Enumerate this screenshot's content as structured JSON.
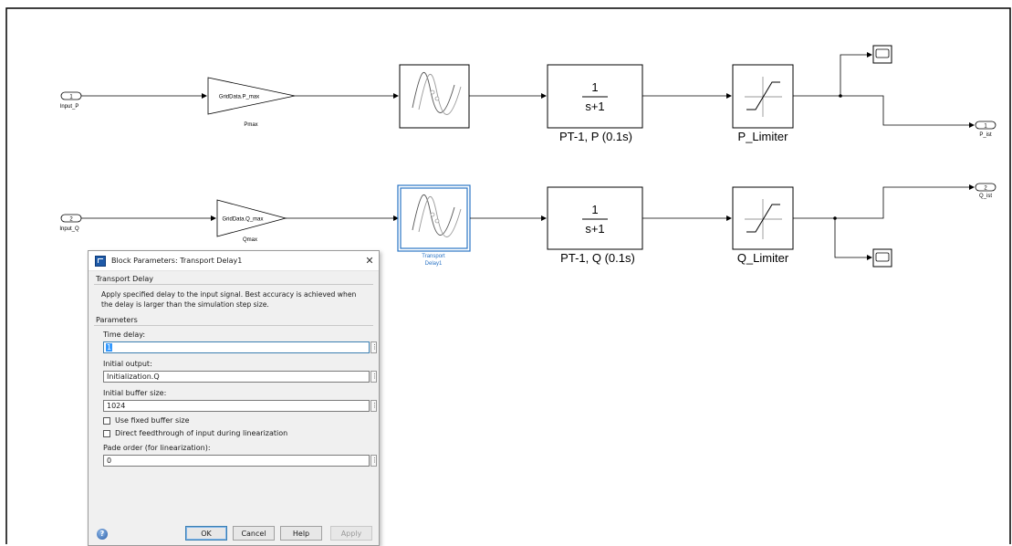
{
  "diagram": {
    "inports": [
      {
        "number": "1",
        "label": "Input_P"
      },
      {
        "number": "2",
        "label": "Input_Q"
      }
    ],
    "gains": [
      {
        "text": "GridData.P_max",
        "label": "Pmax"
      },
      {
        "text": "GridData.Q_max",
        "label": "Qmax"
      }
    ],
    "transport_delay": {
      "label_line1": "Transport",
      "label_line2": "Delay1"
    },
    "transfer_fcns": [
      {
        "numerator": "1",
        "denominator": "s+1",
        "label": "PT-1, P (0.1s)"
      },
      {
        "numerator": "1",
        "denominator": "s+1",
        "label": "PT-1, Q (0.1s)"
      }
    ],
    "limiters": [
      {
        "label": "P_Limiter"
      },
      {
        "label": "Q_Limiter"
      }
    ],
    "outports": [
      {
        "number": "1",
        "label": "P_ist"
      },
      {
        "number": "2",
        "label": "Q_ist"
      }
    ],
    "colors": {
      "selected_block": "#2a74c5",
      "line": "#000000"
    }
  },
  "dialog": {
    "title": "Block Parameters: Transport Delay1",
    "close_icon": "close-icon",
    "block_type": "Transport Delay",
    "description": "Apply specified delay to the input signal.  Best accuracy is achieved when the delay is larger than the simulation step size.",
    "parameters_heading": "Parameters",
    "fields": [
      {
        "label": "Time delay:",
        "value": "1"
      },
      {
        "label": "Initial output:",
        "value": "Initialization.Q"
      },
      {
        "label": "Initial buffer size:",
        "value": "1024"
      }
    ],
    "checkboxes": [
      {
        "label": "Use fixed buffer size",
        "checked": false
      },
      {
        "label": "Direct feedthrough of input during linearization",
        "checked": false
      }
    ],
    "pade": {
      "label": "Pade order (for linearization):",
      "value": "0"
    },
    "more_button": "⋮",
    "buttons": {
      "ok": "OK",
      "cancel": "Cancel",
      "help": "Help",
      "apply": "Apply"
    },
    "help_icon": "?"
  }
}
